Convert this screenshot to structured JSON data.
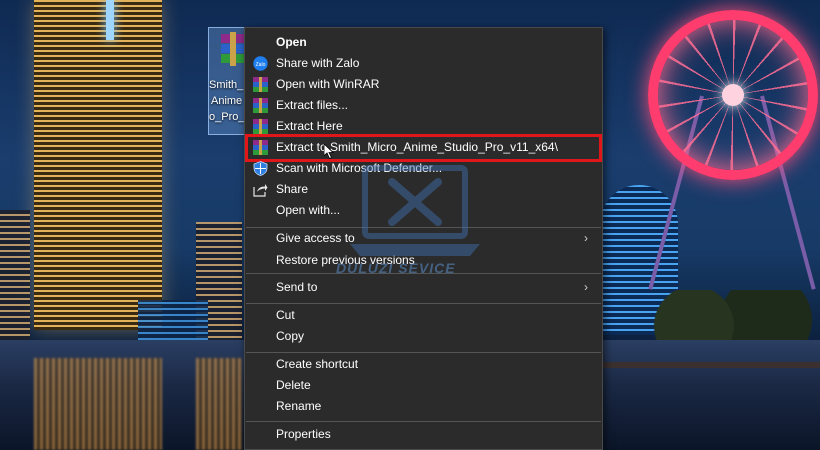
{
  "desktop_icon": {
    "name_lines": [
      "Smith_",
      "Anime",
      "o_Pro_"
    ]
  },
  "context_menu": {
    "items": [
      {
        "label": "Open",
        "icon": "none",
        "bold": true
      },
      {
        "label": "Share with Zalo",
        "icon": "zalo-icon"
      },
      {
        "label": "Open with WinRAR",
        "icon": "winrar-icon"
      },
      {
        "label": "Extract files...",
        "icon": "winrar-icon"
      },
      {
        "label": "Extract Here",
        "icon": "winrar-icon"
      },
      {
        "label": "Extract to Smith_Micro_Anime_Studio_Pro_v11_x64\\",
        "icon": "winrar-icon",
        "highlighted": true
      },
      {
        "label": "Scan with Microsoft Defender...",
        "icon": "defender-shield-icon"
      },
      {
        "label": "Share",
        "icon": "share-icon"
      },
      {
        "label": "Open with...",
        "icon": "none"
      },
      {
        "label": "Give access to",
        "icon": "none",
        "submenu": true
      },
      {
        "label": "Restore previous versions",
        "icon": "none"
      },
      {
        "label": "Send to",
        "icon": "none",
        "submenu": true
      },
      {
        "label": "Cut",
        "icon": "none"
      },
      {
        "label": "Copy",
        "icon": "none"
      },
      {
        "label": "Create shortcut",
        "icon": "none"
      },
      {
        "label": "Delete",
        "icon": "none"
      },
      {
        "label": "Rename",
        "icon": "none"
      },
      {
        "label": "Properties",
        "icon": "none"
      }
    ],
    "submenu_arrow": "›"
  },
  "watermark": {
    "text": "DULUZI SEVICE"
  },
  "colors": {
    "menu_bg": "#2b2b2b",
    "menu_text": "#ffffff",
    "highlight_border": "#e0161b",
    "separator": "#555555"
  }
}
